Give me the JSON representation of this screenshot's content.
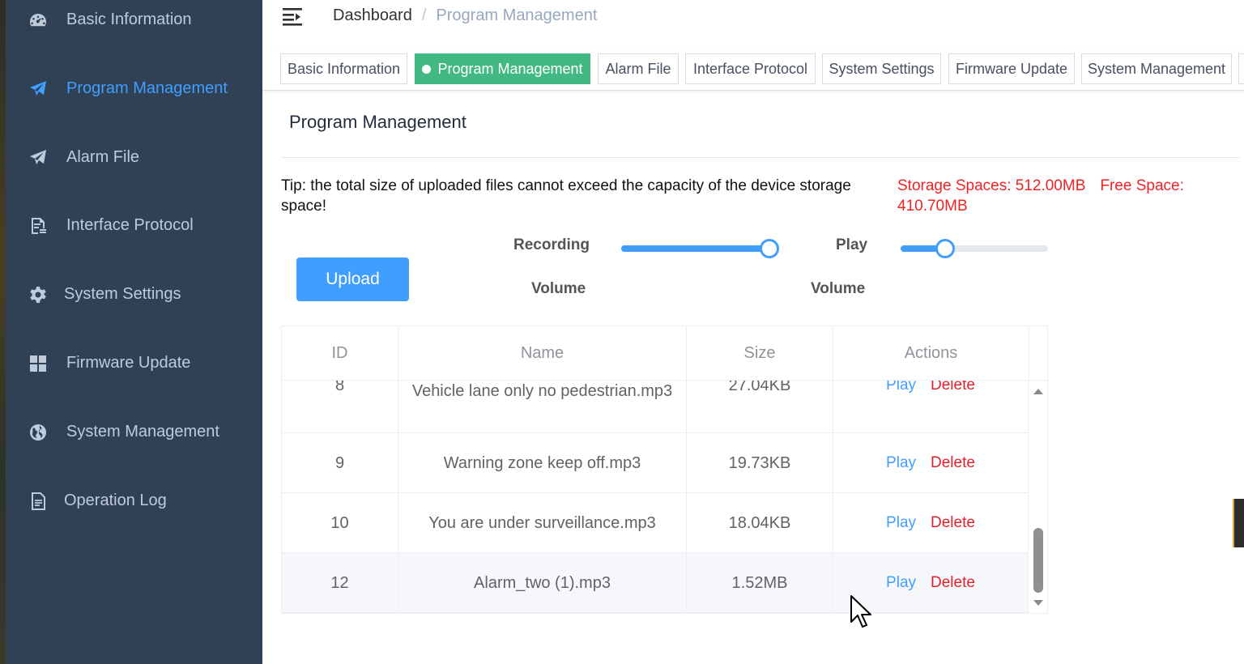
{
  "sidebar": {
    "items": [
      {
        "label": "Basic Information",
        "icon": "dashboard-icon",
        "active": false
      },
      {
        "label": "Program Management",
        "icon": "send-icon",
        "active": true
      },
      {
        "label": "Alarm File",
        "icon": "send-icon",
        "active": false
      },
      {
        "label": "Interface Protocol",
        "icon": "document-icon",
        "active": false
      },
      {
        "label": "System Settings",
        "icon": "gear-icon",
        "active": false
      },
      {
        "label": "Firmware Update",
        "icon": "grid-icon",
        "active": false
      },
      {
        "label": "System Management",
        "icon": "globe-icon",
        "active": false
      },
      {
        "label": "Operation Log",
        "icon": "log-icon",
        "active": false
      }
    ]
  },
  "breadcrumb": {
    "home": "Dashboard",
    "separator": "/",
    "current": "Program Management"
  },
  "tags": [
    {
      "label": "Basic Information",
      "active": false
    },
    {
      "label": "Program Management",
      "active": true
    },
    {
      "label": "Alarm File",
      "active": false
    },
    {
      "label": "Interface Protocol",
      "active": false
    },
    {
      "label": "System Settings",
      "active": false
    },
    {
      "label": "Firmware Update",
      "active": false
    },
    {
      "label": "System Management",
      "active": false
    }
  ],
  "main": {
    "title": "Program Management",
    "tip": "Tip: the total size of uploaded files cannot exceed the capacity of the device storage space!",
    "storage_spaces": "Storage Spaces: 512.00MB",
    "free_space": "Free Space: 410.70MB",
    "upload_label": "Upload",
    "recording_label_1": "Recording",
    "recording_label_2": "Volume",
    "play_label_1": "Play",
    "play_label_2": "Volume",
    "recording_volume_fraction": 1.0,
    "play_volume_fraction": 0.3
  },
  "table": {
    "columns": [
      "ID",
      "Name",
      "Size",
      "Actions"
    ],
    "rows": [
      {
        "id": "8",
        "name": "Vehicle lane only no pedestrian.mp3",
        "size": "27.04KB",
        "play": "Play",
        "delete": "Delete"
      },
      {
        "id": "9",
        "name": "Warning zone keep off.mp3",
        "size": "19.73KB",
        "play": "Play",
        "delete": "Delete"
      },
      {
        "id": "10",
        "name": "You are under surveillance.mp3",
        "size": "18.04KB",
        "play": "Play",
        "delete": "Delete"
      },
      {
        "id": "12",
        "name": "Alarm_two (1).mp3",
        "size": "1.52MB",
        "play": "Play",
        "delete": "Delete"
      }
    ]
  },
  "colors": {
    "sidebar_bg": "#304156",
    "sidebar_text": "#bfcbd9",
    "accent": "#409eff",
    "tag_active": "#42b983",
    "warning_red": "#f02222",
    "delete_red": "#e0202a"
  }
}
